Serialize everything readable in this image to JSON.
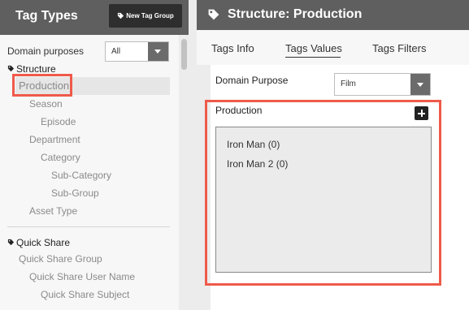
{
  "left": {
    "title": "Tag Types",
    "new_button_label": "New Tag Group",
    "domain_label": "Domain purposes",
    "domain_value": "All",
    "groups": [
      {
        "label": "Structure",
        "items": [
          "Production",
          "Season",
          "Episode",
          "Department",
          "Category",
          "Sub-Category",
          "Sub-Group",
          "Asset Type"
        ]
      },
      {
        "label": "Quick Share",
        "items": [
          "Quick Share Group",
          "Quick Share User Name",
          "Quick Share Subject"
        ]
      }
    ]
  },
  "right": {
    "title": "Structure: Production",
    "tabs": [
      "Tags Info",
      "Tags Values",
      "Tags Filters"
    ],
    "active_tab": "Tags Values",
    "domain_label": "Domain Purpose",
    "domain_value": "Film",
    "values_title": "Production",
    "values": [
      "Iron Man (0)",
      "Iron Man 2 (0)"
    ]
  },
  "colors": {
    "header_bg": "#5f5f5f",
    "highlight": "#ef5a4a",
    "button_dark": "#2e2e2e"
  },
  "icons": [
    "tag-icon",
    "plus-icon",
    "chevron-down-icon"
  ]
}
